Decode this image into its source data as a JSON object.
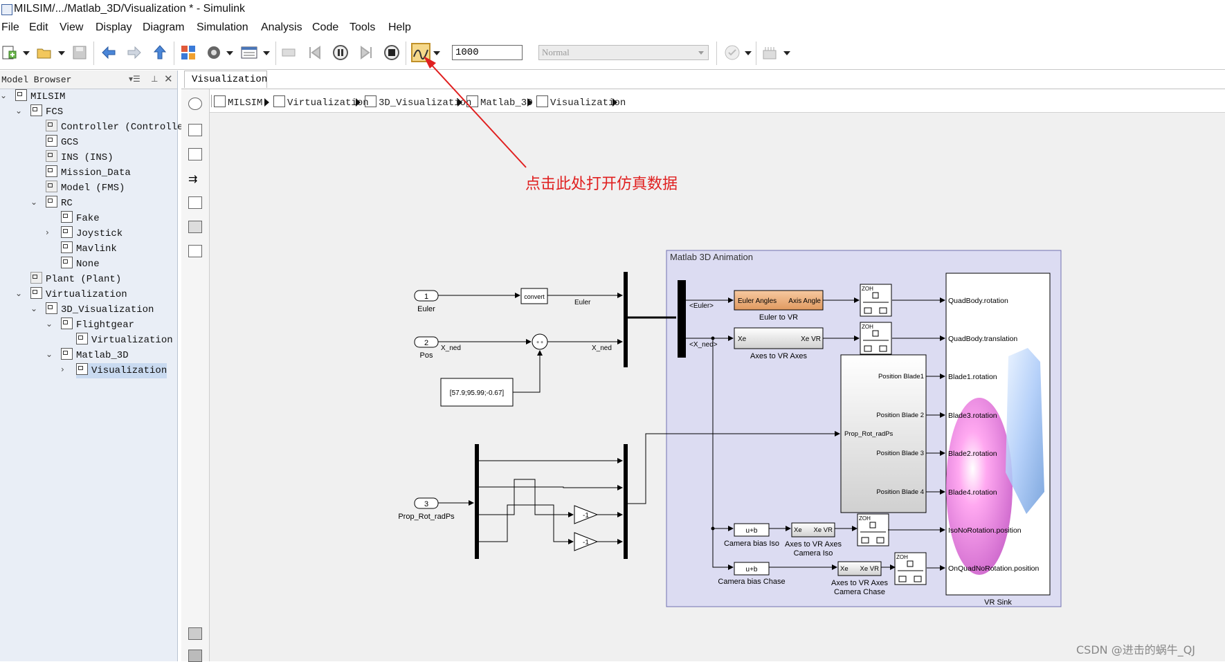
{
  "window": {
    "title": "MILSIM/.../Matlab_3D/Visualization * - Simulink"
  },
  "menu": [
    "File",
    "Edit",
    "View",
    "Display",
    "Diagram",
    "Simulation",
    "Analysis",
    "Code",
    "Tools",
    "Help"
  ],
  "toolbar": {
    "stop_time": "1000",
    "sim_mode": "Normal",
    "icons": [
      "new-model-icon",
      "open-icon",
      "save-icon",
      "back-icon",
      "forward-icon",
      "up-icon",
      "library-browser-icon",
      "model-config-icon",
      "model-explorer-icon",
      "record-icon",
      "step-back-icon",
      "pause-icon",
      "step-forward-icon",
      "stop-icon",
      "simulation-data-inspector-icon",
      "model-advisor-icon",
      "build-icon"
    ]
  },
  "model_browser": {
    "title": "Model Browser",
    "tree": [
      {
        "label": "MILSIM",
        "level": 0,
        "toggle": "expanded",
        "icon": "model"
      },
      {
        "label": "FCS",
        "level": 1,
        "toggle": "expanded",
        "icon": "subsystem"
      },
      {
        "label": "Controller (Controlle",
        "level": 2,
        "toggle": "",
        "icon": "ref"
      },
      {
        "label": "GCS",
        "level": 2,
        "toggle": "",
        "icon": "subsystem"
      },
      {
        "label": "INS (INS)",
        "level": 2,
        "toggle": "",
        "icon": "ref"
      },
      {
        "label": "Mission_Data",
        "level": 2,
        "toggle": "",
        "icon": "subsystem"
      },
      {
        "label": "Model (FMS)",
        "level": 2,
        "toggle": "",
        "icon": "ref"
      },
      {
        "label": "RC",
        "level": 2,
        "toggle": "expanded",
        "icon": "subsystem"
      },
      {
        "label": "Fake",
        "level": 3,
        "toggle": "",
        "icon": "subsystem"
      },
      {
        "label": "Joystick",
        "level": 3,
        "toggle": "collapsed",
        "icon": "subsystem"
      },
      {
        "label": "Mavlink",
        "level": 3,
        "toggle": "",
        "icon": "subsystem"
      },
      {
        "label": "None",
        "level": 3,
        "toggle": "",
        "icon": "subsystem"
      },
      {
        "label": "Plant (Plant)",
        "level": 1,
        "toggle": "",
        "icon": "ref"
      },
      {
        "label": "Virtualization",
        "level": 1,
        "toggle": "expanded",
        "icon": "subsystem"
      },
      {
        "label": "3D_Visualization",
        "level": 2,
        "toggle": "expanded",
        "icon": "subsystem"
      },
      {
        "label": "Flightgear",
        "level": 3,
        "toggle": "expanded",
        "icon": "subsystem"
      },
      {
        "label": "Virtualization",
        "level": 4,
        "toggle": "",
        "icon": "subsystem"
      },
      {
        "label": "Matlab_3D",
        "level": 3,
        "toggle": "expanded",
        "icon": "subsystem"
      },
      {
        "label": "Visualization",
        "level": 4,
        "toggle": "collapsed",
        "icon": "subsystem",
        "selected": true
      }
    ]
  },
  "editor": {
    "tab": "Visualization",
    "breadcrumb": [
      "MILSIM",
      "Virtualization",
      "3D_Visualization",
      "Matlab_3D",
      "Visualization"
    ]
  },
  "diagram": {
    "area_title": "Matlab 3D Animation",
    "inports": [
      {
        "num": "1",
        "name": "Euler"
      },
      {
        "num": "2",
        "name": "Pos"
      },
      {
        "num": "3",
        "name": "Prop_Rot_radPs"
      }
    ],
    "convert_label": "convert",
    "constant_value": "[57.9;95.99;-0.67]",
    "signals": {
      "euler": "Euler",
      "x_ned": "X_ned",
      "x_ned_in": "X_ned",
      "sel_euler": "<Euler>",
      "sel_xned": "<X_ned>",
      "prop": "Prop_Rot_radPs"
    },
    "sum_signs": "+ +",
    "gain_label": "-1",
    "blocks": {
      "euler_to_vr": {
        "in": "Euler Angles",
        "out": "Axis Angle",
        "name": "Euler to VR"
      },
      "axes_to_vr": {
        "in": "Xe",
        "out": "Xe VR",
        "name": "Axes to VR Axes"
      },
      "cam_bias_iso": {
        "label": "u+b",
        "name": "Camera bias Iso"
      },
      "cam_bias_chase": {
        "label": "u+b",
        "name": "Camera bias Chase"
      },
      "axes_iso": {
        "in": "Xe",
        "out": "Xe VR",
        "name": "Axes to VR Axes Camera Iso"
      },
      "axes_chase": {
        "in": "Xe",
        "out": "Xe VR",
        "name": "Axes to VR Axes Camera Chase"
      },
      "zoh": "ZOH",
      "blade": {
        "input": "Prop_Rot_radPs",
        "outputs": [
          "Position Blade1",
          "Position Blade 2",
          "Position Blade 3",
          "Position Blade 4"
        ]
      },
      "vr_sink": {
        "name": "VR Sink",
        "inputs": [
          "QuadBody.rotation",
          "QuadBody.translation",
          "Blade1.rotation",
          "Blade3.rotation",
          "Blade2.rotation",
          "Blade4.rotation",
          "IsoNoRotation.position",
          "OnQuadNoRotation.position"
        ]
      }
    }
  },
  "annotation": "点击此处打开仿真数据",
  "watermark": "CSDN @进击的蜗牛_QJ",
  "colors": {
    "accent_red": "#e02020",
    "orange_block": "#f0b080",
    "area_fill": "#dcdcf2",
    "area_border": "#7070b0",
    "selected": "#c9daf0"
  }
}
